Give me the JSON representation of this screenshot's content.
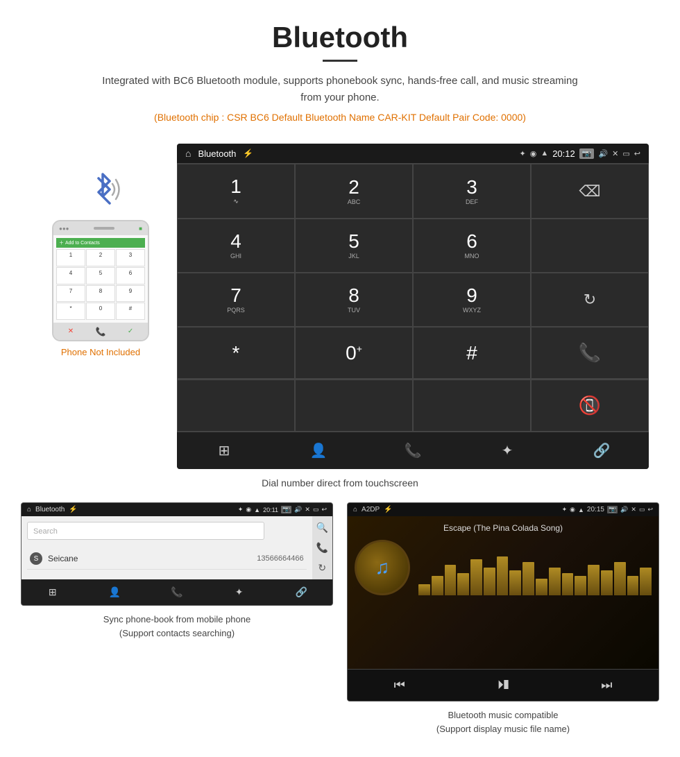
{
  "header": {
    "title": "Bluetooth",
    "description": "Integrated with BC6 Bluetooth module, supports phonebook sync, hands-free call, and music streaming from your phone.",
    "specs": "(Bluetooth chip : CSR BC6    Default Bluetooth Name CAR-KIT    Default Pair Code: 0000)"
  },
  "phone_note": "Phone Not Included",
  "dial_caption": "Dial number direct from touchscreen",
  "dialpad": {
    "status_app": "Bluetooth",
    "status_time": "20:12",
    "keys": [
      {
        "number": "1",
        "letters": ""
      },
      {
        "number": "2",
        "letters": "ABC"
      },
      {
        "number": "3",
        "letters": "DEF"
      },
      {
        "number": "",
        "letters": "",
        "special": "backspace"
      },
      {
        "number": "4",
        "letters": "GHI"
      },
      {
        "number": "5",
        "letters": "JKL"
      },
      {
        "number": "6",
        "letters": "MNO"
      },
      {
        "number": "",
        "letters": "",
        "special": "empty"
      },
      {
        "number": "7",
        "letters": "PQRS"
      },
      {
        "number": "8",
        "letters": "TUV"
      },
      {
        "number": "9",
        "letters": "WXYZ"
      },
      {
        "number": "",
        "letters": "",
        "special": "refresh"
      },
      {
        "number": "*",
        "letters": ""
      },
      {
        "number": "0",
        "letters": "+"
      },
      {
        "number": "#",
        "letters": ""
      },
      {
        "number": "",
        "letters": "",
        "special": "call-green"
      },
      {
        "number": "",
        "letters": "",
        "special": "call-red"
      }
    ],
    "bottom_nav": [
      "grid",
      "person",
      "phone",
      "bluetooth",
      "link"
    ]
  },
  "phonebook": {
    "status_app": "Bluetooth",
    "status_time": "20:11",
    "search_placeholder": "Search",
    "contacts": [
      {
        "letter": "S",
        "name": "Seicane",
        "number": "13566664466"
      }
    ],
    "bottom_nav": [
      "grid",
      "person",
      "phone",
      "bluetooth",
      "link"
    ],
    "caption": "Sync phone-book from mobile phone\n(Support contacts searching)"
  },
  "music": {
    "status_app": "A2DP",
    "status_time": "20:15",
    "song_title": "Escape (The Pina Colada Song)",
    "eq_bars": [
      20,
      35,
      55,
      40,
      65,
      50,
      70,
      45,
      60,
      30,
      50,
      40,
      35,
      55,
      45,
      60,
      35,
      50
    ],
    "controls": [
      "prev",
      "play-pause",
      "next"
    ],
    "caption": "Bluetooth music compatible\n(Support display music file name)"
  }
}
